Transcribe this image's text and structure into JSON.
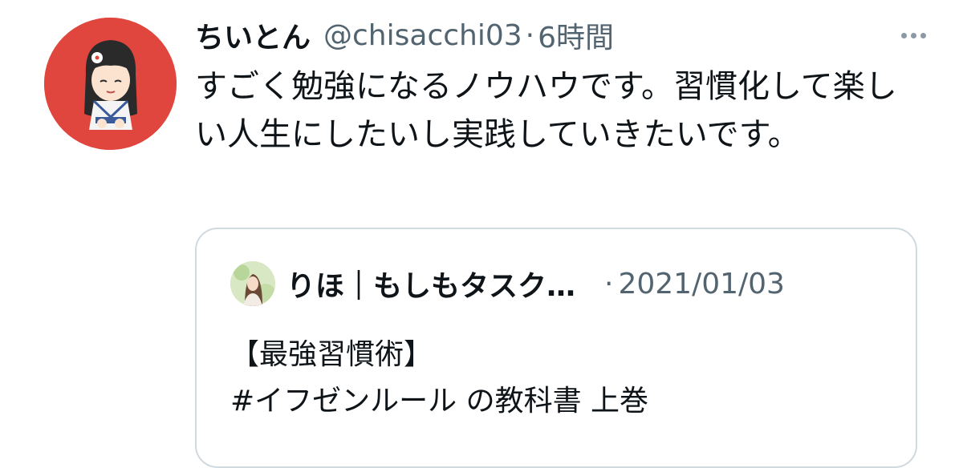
{
  "tweet": {
    "display_name": "ちいとん",
    "handle": "@chisacchi03",
    "separator": "·",
    "time": "6時間",
    "text": "すごく勉強になるノウハウです。習慣化して楽しい人生にしたいし実践していきたいです。",
    "avatar_caption": "chao-chenrio",
    "more_icon": "more-horizontal-icon"
  },
  "quoted_tweet": {
    "display_name": "りほ｜もしもタスク…",
    "separator": "·",
    "date": "2021/01/03",
    "text_line1": "【最強習慣術】",
    "text_line2": "#イフゼンルール の教科書 上巻"
  },
  "colors": {
    "text_primary": "#0f1419",
    "text_secondary": "#536471",
    "card_border": "#cfd9de",
    "avatar_bg": "#e1463e"
  }
}
